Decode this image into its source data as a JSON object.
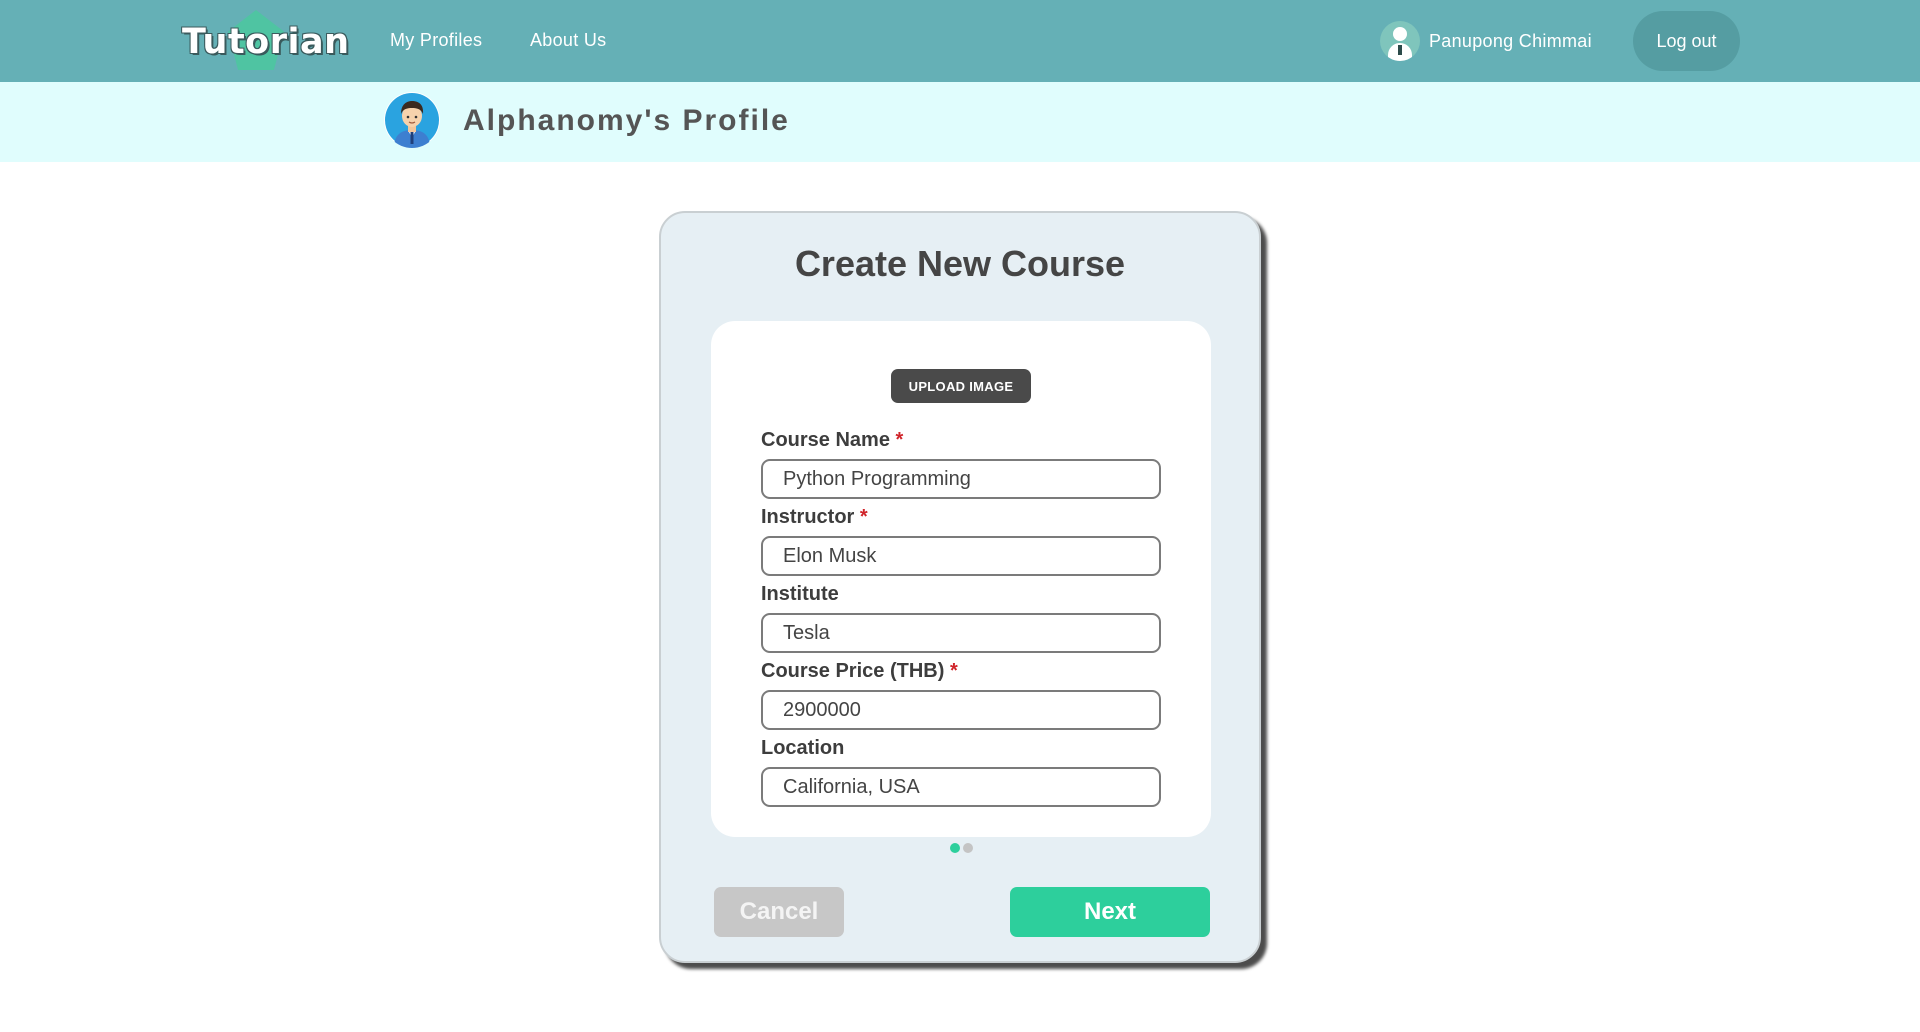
{
  "header": {
    "logo_text": "Tutorian",
    "nav": [
      {
        "label": "My Profiles"
      },
      {
        "label": "About Us"
      }
    ],
    "user_name": "Panupong Chimmai",
    "logout_label": "Log out"
  },
  "banner": {
    "title": "Alphanomy's Profile"
  },
  "form": {
    "title": "Create New Course",
    "upload_label": "UPLOAD IMAGE",
    "required_mark": "*",
    "fields": [
      {
        "label": "Course Name",
        "required": true,
        "value": "Python Programming"
      },
      {
        "label": "Instructor",
        "required": true,
        "value": "Elon Musk"
      },
      {
        "label": "Institute",
        "required": false,
        "value": "Tesla"
      },
      {
        "label": "Course Price (THB)",
        "required": true,
        "value": "2900000"
      },
      {
        "label": "Location",
        "required": false,
        "value": "California, USA"
      }
    ],
    "pager": {
      "current": 1,
      "total": 2
    },
    "cancel_label": "Cancel",
    "next_label": "Next"
  },
  "colors": {
    "topbar": "#65b0b6",
    "banner": "#e0fdfd",
    "accent": "#2dcf9c",
    "required": "#d0242a"
  }
}
